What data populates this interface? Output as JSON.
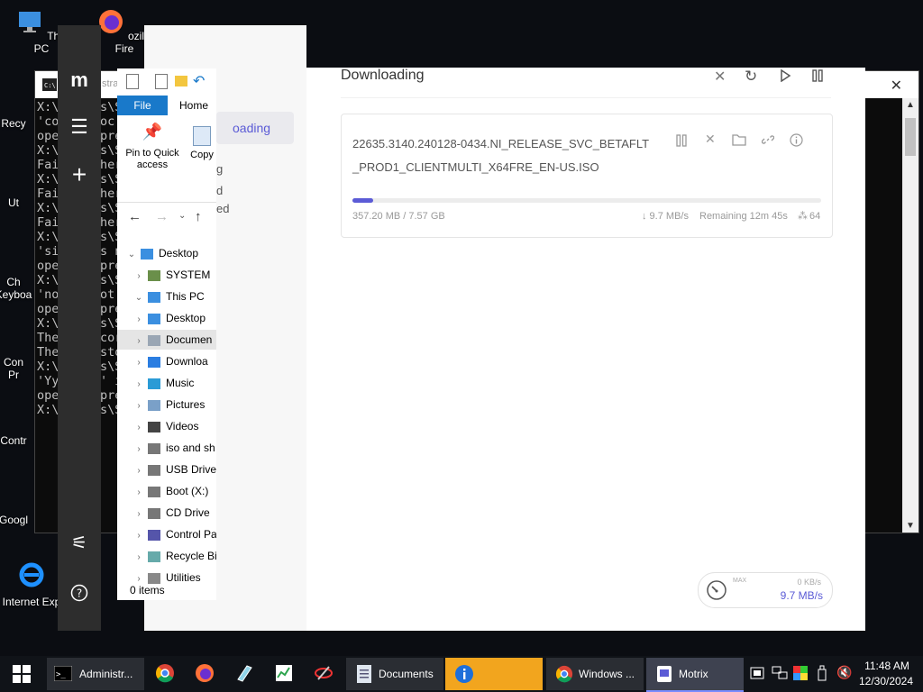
{
  "desktop": {
    "icons": [
      {
        "label": "This PC"
      },
      {
        "label": "ozilla Fire"
      },
      {
        "label": "Recy"
      },
      {
        "label": "Ut"
      },
      {
        "label": "Ch"
      },
      {
        "label": "Keyboa"
      },
      {
        "label": "Con"
      },
      {
        "label": "Pr"
      },
      {
        "label": "Contr"
      },
      {
        "label": "Googl"
      },
      {
        "label": "Internet Exp"
      }
    ]
  },
  "cmd": {
    "title_fragment": "stra",
    "lines": [
      "X:\\",
      "'co",
      "ope",
      "X:\\",
      "Fai",
      "X:\\",
      "Fai",
      "X:\\",
      "Fai",
      "X:\\",
      "'si",
      "ope",
      "X:\\",
      "'no",
      "ope",
      "X:\\",
      "The",
      "The",
      "X:\\",
      "'Yy",
      "ope",
      "X:\\"
    ],
    "lines_right": [
      "s\\S",
      "oc",
      "pre",
      "s\\S",
      "her",
      "s\\S",
      "her",
      "s\\S",
      "her",
      "s\\S",
      "s n",
      "pre",
      "s\\S",
      "ot",
      "pre",
      "s\\S",
      "cor",
      "sto",
      "s\\S",
      "' i",
      "pre",
      "s\\S"
    ]
  },
  "explorer": {
    "tab_file": "File",
    "tab_home": "Home",
    "pin_label_1": "Pin to Quick",
    "pin_label_2": "access",
    "copy_label": "Copy",
    "tree": [
      {
        "label": "Desktop",
        "level": 0
      },
      {
        "label": "SYSTEM",
        "level": 1
      },
      {
        "label": "This PC",
        "level": 1
      },
      {
        "label": "Desktop",
        "level": 2
      },
      {
        "label": "Documen",
        "level": 2
      },
      {
        "label": "Downloa",
        "level": 2
      },
      {
        "label": "Music",
        "level": 2
      },
      {
        "label": "Pictures",
        "level": 2
      },
      {
        "label": "Videos",
        "level": 2
      },
      {
        "label": "iso and sh",
        "level": 2
      },
      {
        "label": "USB Drive",
        "level": 2
      },
      {
        "label": "Boot (X:)",
        "level": 2
      },
      {
        "label": "CD Drive",
        "level": 2
      },
      {
        "label": "Control Pa",
        "level": 1
      },
      {
        "label": "Recycle Bir",
        "level": 1
      },
      {
        "label": "Utilities",
        "level": 1
      }
    ],
    "status": "0 items"
  },
  "motrix": {
    "list_active": "oading",
    "list_items": [
      "g",
      "d",
      "ed"
    ],
    "header_title": "Downloading",
    "task": {
      "name_line1": "22635.3140.240128-0434.NI_RELEASE_SVC_BETAFLT",
      "name_line2": "_PROD1_CLIENTMULTI_X64FRE_EN-US.ISO",
      "progress_fraction": 0.045,
      "size_text": "357.20 MB / 7.57 GB",
      "speed_text": "↓ 9.7 MB/s",
      "remaining_text": "Remaining 12m 45s",
      "connections_text": "64"
    },
    "speed": {
      "max_label": "MAX",
      "upload": "0 KB/s",
      "download": "9.7 MB/s"
    }
  },
  "taskbar": {
    "buttons": [
      {
        "label": "Administr..."
      },
      {
        "label": "Documents"
      },
      {
        "label": "Windows ..."
      },
      {
        "label": "Motrix"
      }
    ],
    "time": "11:48 AM",
    "date": "12/30/2024"
  },
  "colors": {
    "accent": "#5b5bd6",
    "file_tab": "#1979ca",
    "taskbar": "#101318"
  }
}
